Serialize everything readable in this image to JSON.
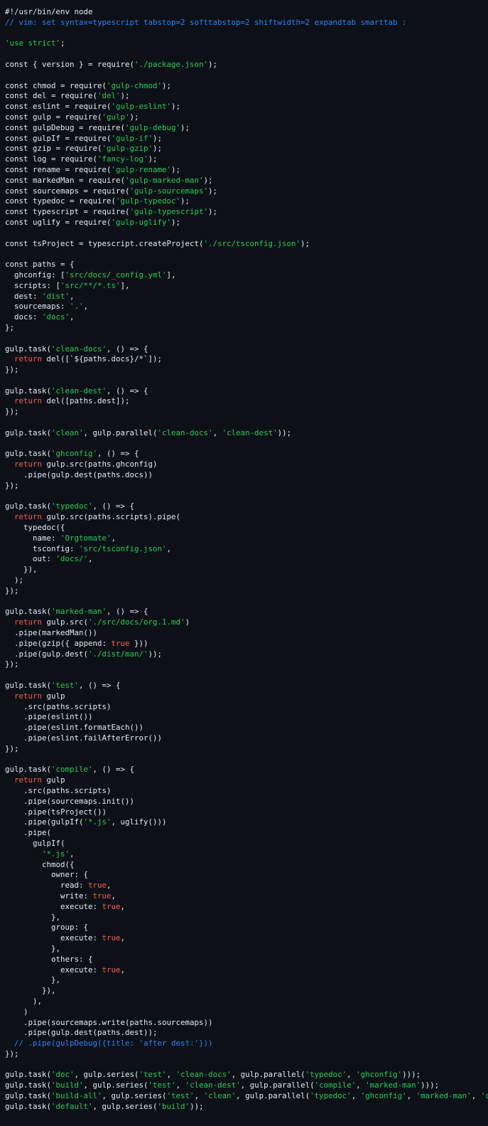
{
  "colors": {
    "background": "#0d1117",
    "plain": "#e6edf3",
    "string": "#27cc58",
    "comment": "#2f81f7",
    "keyword": "#ff5a4f",
    "boolean": "#ff5a4f"
  },
  "code_lines": [
    [
      {
        "t": "p",
        "v": "#!/usr/bin/env node"
      }
    ],
    [
      {
        "t": "c",
        "v": "// vim: set syntax=typescript tabstop=2 softtabstop=2 shiftwidth=2 expandtab smarttab :"
      }
    ],
    [],
    [
      {
        "t": "s",
        "v": "'use strict'"
      },
      {
        "t": "p",
        "v": ";"
      }
    ],
    [],
    [
      {
        "t": "p",
        "v": "const { version } = require("
      },
      {
        "t": "s",
        "v": "'./package.json'"
      },
      {
        "t": "p",
        "v": ");"
      }
    ],
    [],
    [
      {
        "t": "p",
        "v": "const chmod = require("
      },
      {
        "t": "s",
        "v": "'gulp-chmod'"
      },
      {
        "t": "p",
        "v": ");"
      }
    ],
    [
      {
        "t": "p",
        "v": "const del = require("
      },
      {
        "t": "s",
        "v": "'del'"
      },
      {
        "t": "p",
        "v": ");"
      }
    ],
    [
      {
        "t": "p",
        "v": "const eslint = require("
      },
      {
        "t": "s",
        "v": "'gulp-eslint'"
      },
      {
        "t": "p",
        "v": ");"
      }
    ],
    [
      {
        "t": "p",
        "v": "const gulp = require("
      },
      {
        "t": "s",
        "v": "'gulp'"
      },
      {
        "t": "p",
        "v": ");"
      }
    ],
    [
      {
        "t": "p",
        "v": "const gulpDebug = require("
      },
      {
        "t": "s",
        "v": "'gulp-debug'"
      },
      {
        "t": "p",
        "v": ");"
      }
    ],
    [
      {
        "t": "p",
        "v": "const gulpIf = require("
      },
      {
        "t": "s",
        "v": "'gulp-if'"
      },
      {
        "t": "p",
        "v": ");"
      }
    ],
    [
      {
        "t": "p",
        "v": "const gzip = require("
      },
      {
        "t": "s",
        "v": "'gulp-gzip'"
      },
      {
        "t": "p",
        "v": ");"
      }
    ],
    [
      {
        "t": "p",
        "v": "const log = require("
      },
      {
        "t": "s",
        "v": "'fancy-log'"
      },
      {
        "t": "p",
        "v": ");"
      }
    ],
    [
      {
        "t": "p",
        "v": "const rename = require("
      },
      {
        "t": "s",
        "v": "'gulp-rename'"
      },
      {
        "t": "p",
        "v": ");"
      }
    ],
    [
      {
        "t": "p",
        "v": "const markedMan = require("
      },
      {
        "t": "s",
        "v": "'gulp-marked-man'"
      },
      {
        "t": "p",
        "v": ");"
      }
    ],
    [
      {
        "t": "p",
        "v": "const sourcemaps = require("
      },
      {
        "t": "s",
        "v": "'gulp-sourcemaps'"
      },
      {
        "t": "p",
        "v": ");"
      }
    ],
    [
      {
        "t": "p",
        "v": "const typedoc = require("
      },
      {
        "t": "s",
        "v": "'gulp-typedoc'"
      },
      {
        "t": "p",
        "v": ");"
      }
    ],
    [
      {
        "t": "p",
        "v": "const typescript = require("
      },
      {
        "t": "s",
        "v": "'gulp-typescript'"
      },
      {
        "t": "p",
        "v": ");"
      }
    ],
    [
      {
        "t": "p",
        "v": "const uglify = require("
      },
      {
        "t": "s",
        "v": "'gulp-uglify'"
      },
      {
        "t": "p",
        "v": ");"
      }
    ],
    [],
    [
      {
        "t": "p",
        "v": "const tsProject = typescript.createProject("
      },
      {
        "t": "s",
        "v": "'./src/tsconfig.json'"
      },
      {
        "t": "p",
        "v": ");"
      }
    ],
    [],
    [
      {
        "t": "p",
        "v": "const paths = {"
      }
    ],
    [
      {
        "t": "p",
        "v": "  ghconfig: ["
      },
      {
        "t": "s",
        "v": "'src/docs/_config.yml'"
      },
      {
        "t": "p",
        "v": "],"
      }
    ],
    [
      {
        "t": "p",
        "v": "  scripts: ["
      },
      {
        "t": "s",
        "v": "'src/**/*.ts'"
      },
      {
        "t": "p",
        "v": "],"
      }
    ],
    [
      {
        "t": "p",
        "v": "  dest: "
      },
      {
        "t": "s",
        "v": "'dist'"
      },
      {
        "t": "p",
        "v": ","
      }
    ],
    [
      {
        "t": "p",
        "v": "  sourcemaps: "
      },
      {
        "t": "s",
        "v": "'.'"
      },
      {
        "t": "p",
        "v": ","
      }
    ],
    [
      {
        "t": "p",
        "v": "  docs: "
      },
      {
        "t": "s",
        "v": "'docs'"
      },
      {
        "t": "p",
        "v": ","
      }
    ],
    [
      {
        "t": "p",
        "v": "};"
      }
    ],
    [],
    [
      {
        "t": "p",
        "v": "gulp.task("
      },
      {
        "t": "s",
        "v": "'clean-docs'"
      },
      {
        "t": "p",
        "v": ", () => {"
      }
    ],
    [
      {
        "t": "p",
        "v": "  "
      },
      {
        "t": "k",
        "v": "return"
      },
      {
        "t": "p",
        "v": " del([`${paths.docs}/*`]);"
      }
    ],
    [
      {
        "t": "p",
        "v": "});"
      }
    ],
    [],
    [
      {
        "t": "p",
        "v": "gulp.task("
      },
      {
        "t": "s",
        "v": "'clean-dest'"
      },
      {
        "t": "p",
        "v": ", () => {"
      }
    ],
    [
      {
        "t": "p",
        "v": "  "
      },
      {
        "t": "k",
        "v": "return"
      },
      {
        "t": "p",
        "v": " del([paths.dest]);"
      }
    ],
    [
      {
        "t": "p",
        "v": "});"
      }
    ],
    [],
    [
      {
        "t": "p",
        "v": "gulp.task("
      },
      {
        "t": "s",
        "v": "'clean'"
      },
      {
        "t": "p",
        "v": ", gulp.parallel("
      },
      {
        "t": "s",
        "v": "'clean-docs'"
      },
      {
        "t": "p",
        "v": ", "
      },
      {
        "t": "s",
        "v": "'clean-dest'"
      },
      {
        "t": "p",
        "v": "));"
      }
    ],
    [],
    [
      {
        "t": "p",
        "v": "gulp.task("
      },
      {
        "t": "s",
        "v": "'ghconfig'"
      },
      {
        "t": "p",
        "v": ", () => {"
      }
    ],
    [
      {
        "t": "p",
        "v": "  "
      },
      {
        "t": "k",
        "v": "return"
      },
      {
        "t": "p",
        "v": " gulp.src(paths.ghconfig)"
      }
    ],
    [
      {
        "t": "p",
        "v": "    .pipe(gulp.dest(paths.docs))"
      }
    ],
    [
      {
        "t": "p",
        "v": "});"
      }
    ],
    [],
    [
      {
        "t": "p",
        "v": "gulp.task("
      },
      {
        "t": "s",
        "v": "'typedoc'"
      },
      {
        "t": "p",
        "v": ", () => {"
      }
    ],
    [
      {
        "t": "p",
        "v": "  "
      },
      {
        "t": "k",
        "v": "return"
      },
      {
        "t": "p",
        "v": " gulp.src(paths.scripts).pipe("
      }
    ],
    [
      {
        "t": "p",
        "v": "    typedoc({"
      }
    ],
    [
      {
        "t": "p",
        "v": "      name: "
      },
      {
        "t": "s",
        "v": "'Orgtomate'"
      },
      {
        "t": "p",
        "v": ","
      }
    ],
    [
      {
        "t": "p",
        "v": "      tsconfig: "
      },
      {
        "t": "s",
        "v": "'src/tsconfig.json'"
      },
      {
        "t": "p",
        "v": ","
      }
    ],
    [
      {
        "t": "p",
        "v": "      out: "
      },
      {
        "t": "s",
        "v": "'docs/'"
      },
      {
        "t": "p",
        "v": ","
      }
    ],
    [
      {
        "t": "p",
        "v": "    }),"
      }
    ],
    [
      {
        "t": "p",
        "v": "  );"
      }
    ],
    [
      {
        "t": "p",
        "v": "});"
      }
    ],
    [],
    [
      {
        "t": "p",
        "v": "gulp.task("
      },
      {
        "t": "s",
        "v": "'marked-man'"
      },
      {
        "t": "p",
        "v": ", () => {"
      }
    ],
    [
      {
        "t": "p",
        "v": "  "
      },
      {
        "t": "k",
        "v": "return"
      },
      {
        "t": "p",
        "v": " gulp.src("
      },
      {
        "t": "s",
        "v": "'./src/docs/org.1.md'"
      },
      {
        "t": "p",
        "v": ")"
      }
    ],
    [
      {
        "t": "p",
        "v": "  .pipe(markedMan())"
      }
    ],
    [
      {
        "t": "p",
        "v": "  .pipe(gzip({ append: "
      },
      {
        "t": "b",
        "v": "true"
      },
      {
        "t": "p",
        "v": " }))"
      }
    ],
    [
      {
        "t": "p",
        "v": "  .pipe(gulp.dest("
      },
      {
        "t": "s",
        "v": "'./dist/man/'"
      },
      {
        "t": "p",
        "v": "));"
      }
    ],
    [
      {
        "t": "p",
        "v": "});"
      }
    ],
    [],
    [
      {
        "t": "p",
        "v": "gulp.task("
      },
      {
        "t": "s",
        "v": "'test'"
      },
      {
        "t": "p",
        "v": ", () => {"
      }
    ],
    [
      {
        "t": "p",
        "v": "  "
      },
      {
        "t": "k",
        "v": "return"
      },
      {
        "t": "p",
        "v": " gulp"
      }
    ],
    [
      {
        "t": "p",
        "v": "    .src(paths.scripts)"
      }
    ],
    [
      {
        "t": "p",
        "v": "    .pipe(eslint())"
      }
    ],
    [
      {
        "t": "p",
        "v": "    .pipe(eslint.formatEach())"
      }
    ],
    [
      {
        "t": "p",
        "v": "    .pipe(eslint.failAfterError())"
      }
    ],
    [
      {
        "t": "p",
        "v": "});"
      }
    ],
    [],
    [
      {
        "t": "p",
        "v": "gulp.task("
      },
      {
        "t": "s",
        "v": "'compile'"
      },
      {
        "t": "p",
        "v": ", () => {"
      }
    ],
    [
      {
        "t": "p",
        "v": "  "
      },
      {
        "t": "k",
        "v": "return"
      },
      {
        "t": "p",
        "v": " gulp"
      }
    ],
    [
      {
        "t": "p",
        "v": "    .src(paths.scripts)"
      }
    ],
    [
      {
        "t": "p",
        "v": "    .pipe(sourcemaps.init())"
      }
    ],
    [
      {
        "t": "p",
        "v": "    .pipe(tsProject())"
      }
    ],
    [
      {
        "t": "p",
        "v": "    .pipe(gulpIf("
      },
      {
        "t": "s",
        "v": "'*.js'"
      },
      {
        "t": "p",
        "v": ", uglify()))"
      }
    ],
    [
      {
        "t": "p",
        "v": "    .pipe("
      }
    ],
    [
      {
        "t": "p",
        "v": "      gulpIf("
      }
    ],
    [
      {
        "t": "p",
        "v": "        "
      },
      {
        "t": "s",
        "v": "'*.js'"
      },
      {
        "t": "p",
        "v": ","
      }
    ],
    [
      {
        "t": "p",
        "v": "        chmod({"
      }
    ],
    [
      {
        "t": "p",
        "v": "          owner: {"
      }
    ],
    [
      {
        "t": "p",
        "v": "            read: "
      },
      {
        "t": "b",
        "v": "true"
      },
      {
        "t": "p",
        "v": ","
      }
    ],
    [
      {
        "t": "p",
        "v": "            write: "
      },
      {
        "t": "b",
        "v": "true"
      },
      {
        "t": "p",
        "v": ","
      }
    ],
    [
      {
        "t": "p",
        "v": "            execute: "
      },
      {
        "t": "b",
        "v": "true"
      },
      {
        "t": "p",
        "v": ","
      }
    ],
    [
      {
        "t": "p",
        "v": "          },"
      }
    ],
    [
      {
        "t": "p",
        "v": "          group: {"
      }
    ],
    [
      {
        "t": "p",
        "v": "            execute: "
      },
      {
        "t": "b",
        "v": "true"
      },
      {
        "t": "p",
        "v": ","
      }
    ],
    [
      {
        "t": "p",
        "v": "          },"
      }
    ],
    [
      {
        "t": "p",
        "v": "          others: {"
      }
    ],
    [
      {
        "t": "p",
        "v": "            execute: "
      },
      {
        "t": "b",
        "v": "true"
      },
      {
        "t": "p",
        "v": ","
      }
    ],
    [
      {
        "t": "p",
        "v": "          },"
      }
    ],
    [
      {
        "t": "p",
        "v": "        }),"
      }
    ],
    [
      {
        "t": "p",
        "v": "      ),"
      }
    ],
    [
      {
        "t": "p",
        "v": "    )"
      }
    ],
    [
      {
        "t": "p",
        "v": "    .pipe(sourcemaps.write(paths.sourcemaps))"
      }
    ],
    [
      {
        "t": "p",
        "v": "    .pipe(gulp.dest(paths.dest));"
      }
    ],
    [
      {
        "t": "c",
        "v": "  // .pipe(gulpDebug({title: 'after dest:'}))"
      }
    ],
    [
      {
        "t": "p",
        "v": "});"
      }
    ],
    [],
    [
      {
        "t": "p",
        "v": "gulp.task("
      },
      {
        "t": "s",
        "v": "'doc'"
      },
      {
        "t": "p",
        "v": ", gulp.series("
      },
      {
        "t": "s",
        "v": "'test'"
      },
      {
        "t": "p",
        "v": ", "
      },
      {
        "t": "s",
        "v": "'clean-docs'"
      },
      {
        "t": "p",
        "v": ", gulp.parallel("
      },
      {
        "t": "s",
        "v": "'typedoc'"
      },
      {
        "t": "p",
        "v": ", "
      },
      {
        "t": "s",
        "v": "'ghconfig'"
      },
      {
        "t": "p",
        "v": ")));"
      }
    ],
    [
      {
        "t": "p",
        "v": "gulp.task("
      },
      {
        "t": "s",
        "v": "'build'"
      },
      {
        "t": "p",
        "v": ", gulp.series("
      },
      {
        "t": "s",
        "v": "'test'"
      },
      {
        "t": "p",
        "v": ", "
      },
      {
        "t": "s",
        "v": "'clean-dest'"
      },
      {
        "t": "p",
        "v": ", gulp.parallel("
      },
      {
        "t": "s",
        "v": "'compile'"
      },
      {
        "t": "p",
        "v": ", "
      },
      {
        "t": "s",
        "v": "'marked-man'"
      },
      {
        "t": "p",
        "v": ")));"
      }
    ],
    [
      {
        "t": "p",
        "v": "gulp.task("
      },
      {
        "t": "s",
        "v": "'build-all'"
      },
      {
        "t": "p",
        "v": ", gulp.series("
      },
      {
        "t": "s",
        "v": "'test'"
      },
      {
        "t": "p",
        "v": ", "
      },
      {
        "t": "s",
        "v": "'clean'"
      },
      {
        "t": "p",
        "v": ", gulp.parallel("
      },
      {
        "t": "s",
        "v": "'typedoc'"
      },
      {
        "t": "p",
        "v": ", "
      },
      {
        "t": "s",
        "v": "'ghconfig'"
      },
      {
        "t": "p",
        "v": ", "
      },
      {
        "t": "s",
        "v": "'marked-man'"
      },
      {
        "t": "p",
        "v": ", "
      },
      {
        "t": "s",
        "v": "'compile'"
      },
      {
        "t": "p",
        "v": ")));"
      }
    ],
    [
      {
        "t": "p",
        "v": "gulp.task("
      },
      {
        "t": "s",
        "v": "'default'"
      },
      {
        "t": "p",
        "v": ", gulp.series("
      },
      {
        "t": "s",
        "v": "'build'"
      },
      {
        "t": "p",
        "v": "));"
      }
    ]
  ]
}
